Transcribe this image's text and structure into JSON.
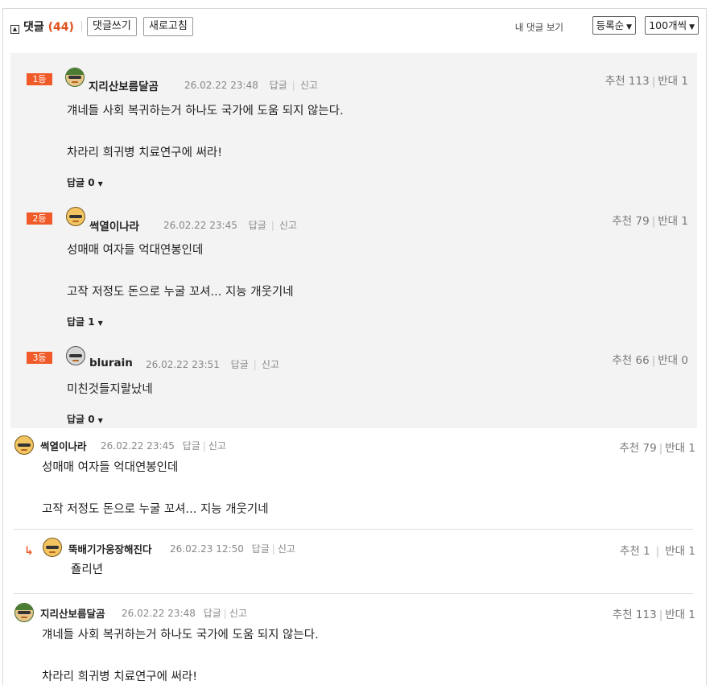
{
  "header": {
    "title": "댓글",
    "count": "(44)",
    "write_button": "댓글쓰기",
    "refresh_button": "새로고침",
    "my_comments": "내 댓글 보기",
    "sort_select": "등록순",
    "per_page_select": "100개씩"
  },
  "labels": {
    "reply": "답글",
    "report": "신고",
    "up": "추천",
    "down": "반대"
  },
  "best": [
    {
      "rank": "1등",
      "user": "지리산보름달곰",
      "date": "26.02.22 23:48",
      "up": "113",
      "down": "1",
      "line1": "걔네들 사회 복귀하는거 하나도 국가에 도움 되지 않는다.",
      "line2": "차라리 희귀병 치료연구에 써라!",
      "replies": "답글 0"
    },
    {
      "rank": "2등",
      "user": "썩열이나라",
      "date": "26.02.22 23:45",
      "up": "79",
      "down": "1",
      "line1": "성매매 여자들 억대연봉인데",
      "line2": "고작 저정도 돈으로 누굴 꼬셔... 지능 개웃기네",
      "replies": "답글 1"
    },
    {
      "rank": "3등",
      "user": "blurain",
      "date": "26.02.22 23:51",
      "up": "66",
      "down": "0",
      "line1": "미친것들지랄났네",
      "line2": "",
      "replies": "답글 0"
    }
  ],
  "comments": [
    {
      "user": "썩열이나라",
      "date": "26.02.22 23:45",
      "up": "79",
      "down": "1",
      "line1": "성매매 여자들 억대연봉인데",
      "line2": "고작 저정도 돈으로 누굴 꼬셔... 지능 개웃기네"
    },
    {
      "reply_arrow": "↳",
      "user": "뚝배기가웅장해진다",
      "date": "26.02.23 12:50",
      "up": "1",
      "down": "1",
      "line1": "죨리년"
    },
    {
      "user": "지리산보름달곰",
      "date": "26.02.22 23:48",
      "up": "113",
      "down": "1",
      "line1": "걔네들 사회 복귀하는거 하나도 국가에 도움 되지 않는다.",
      "line2": "차라리 희귀병 치료연구에 써라!"
    }
  ],
  "colors": {
    "accent": "#f05a28",
    "best_bg": "#f3f3f3"
  }
}
